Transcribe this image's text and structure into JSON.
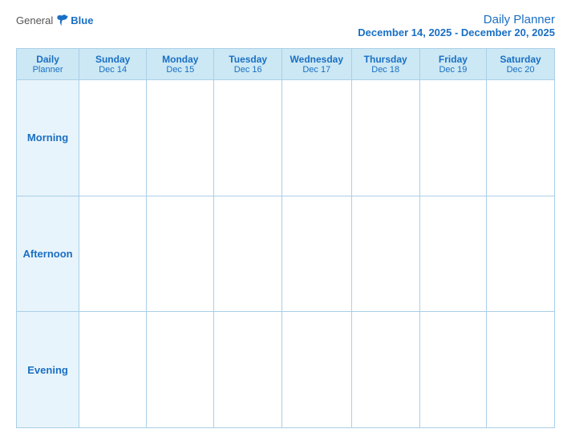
{
  "header": {
    "logo": {
      "general": "General",
      "blue": "Blue"
    },
    "title": "Daily Planner",
    "date_range": "December 14, 2025 - December 20, 2025"
  },
  "columns": [
    {
      "day": "Daily",
      "day2": "Planner",
      "date": ""
    },
    {
      "day": "Sunday",
      "date": "Dec 14"
    },
    {
      "day": "Monday",
      "date": "Dec 15"
    },
    {
      "day": "Tuesday",
      "date": "Dec 16"
    },
    {
      "day": "Wednesday",
      "date": "Dec 17"
    },
    {
      "day": "Thursday",
      "date": "Dec 18"
    },
    {
      "day": "Friday",
      "date": "Dec 19"
    },
    {
      "day": "Saturday",
      "date": "Dec 20"
    }
  ],
  "rows": [
    {
      "label": "Morning"
    },
    {
      "label": "Afternoon"
    },
    {
      "label": "Evening"
    }
  ]
}
